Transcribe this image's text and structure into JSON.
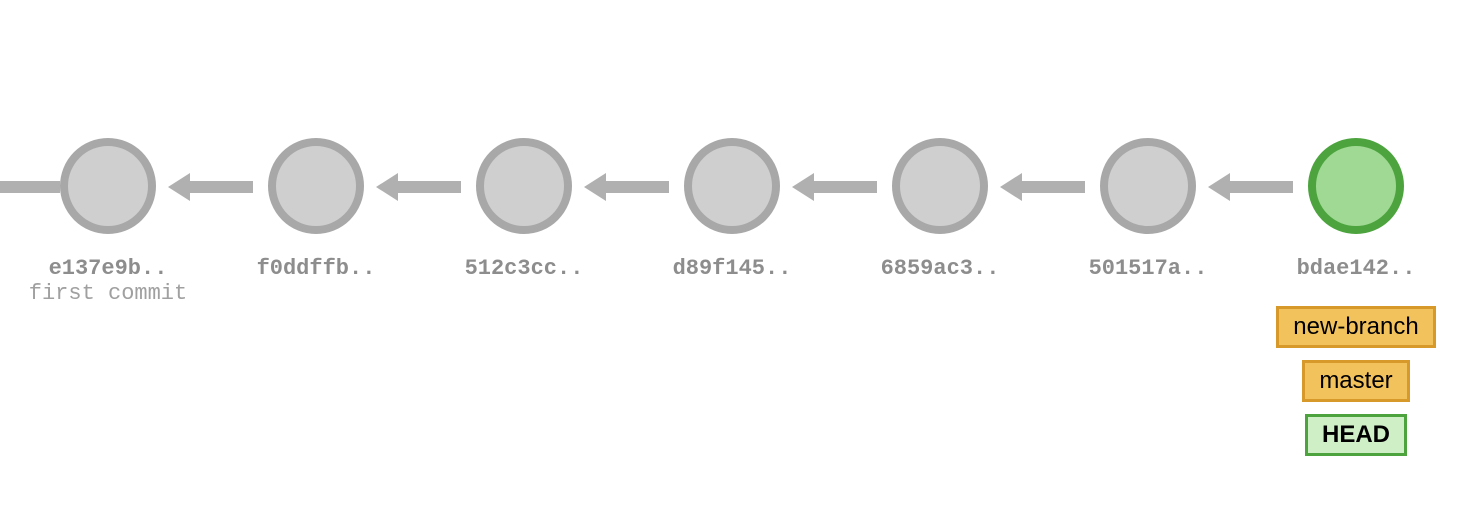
{
  "commits": [
    {
      "hash": "e137e9b..",
      "message": "first commit",
      "is_head": false
    },
    {
      "hash": "f0ddffb..",
      "message": "",
      "is_head": false
    },
    {
      "hash": "512c3cc..",
      "message": "",
      "is_head": false
    },
    {
      "hash": "d89f145..",
      "message": "",
      "is_head": false
    },
    {
      "hash": "6859ac3..",
      "message": "",
      "is_head": false
    },
    {
      "hash": "501517a..",
      "message": "",
      "is_head": false
    },
    {
      "hash": "bdae142..",
      "message": "",
      "is_head": true
    }
  ],
  "branches": [
    {
      "name": "new-branch"
    },
    {
      "name": "master"
    }
  ],
  "head_label": "HEAD"
}
